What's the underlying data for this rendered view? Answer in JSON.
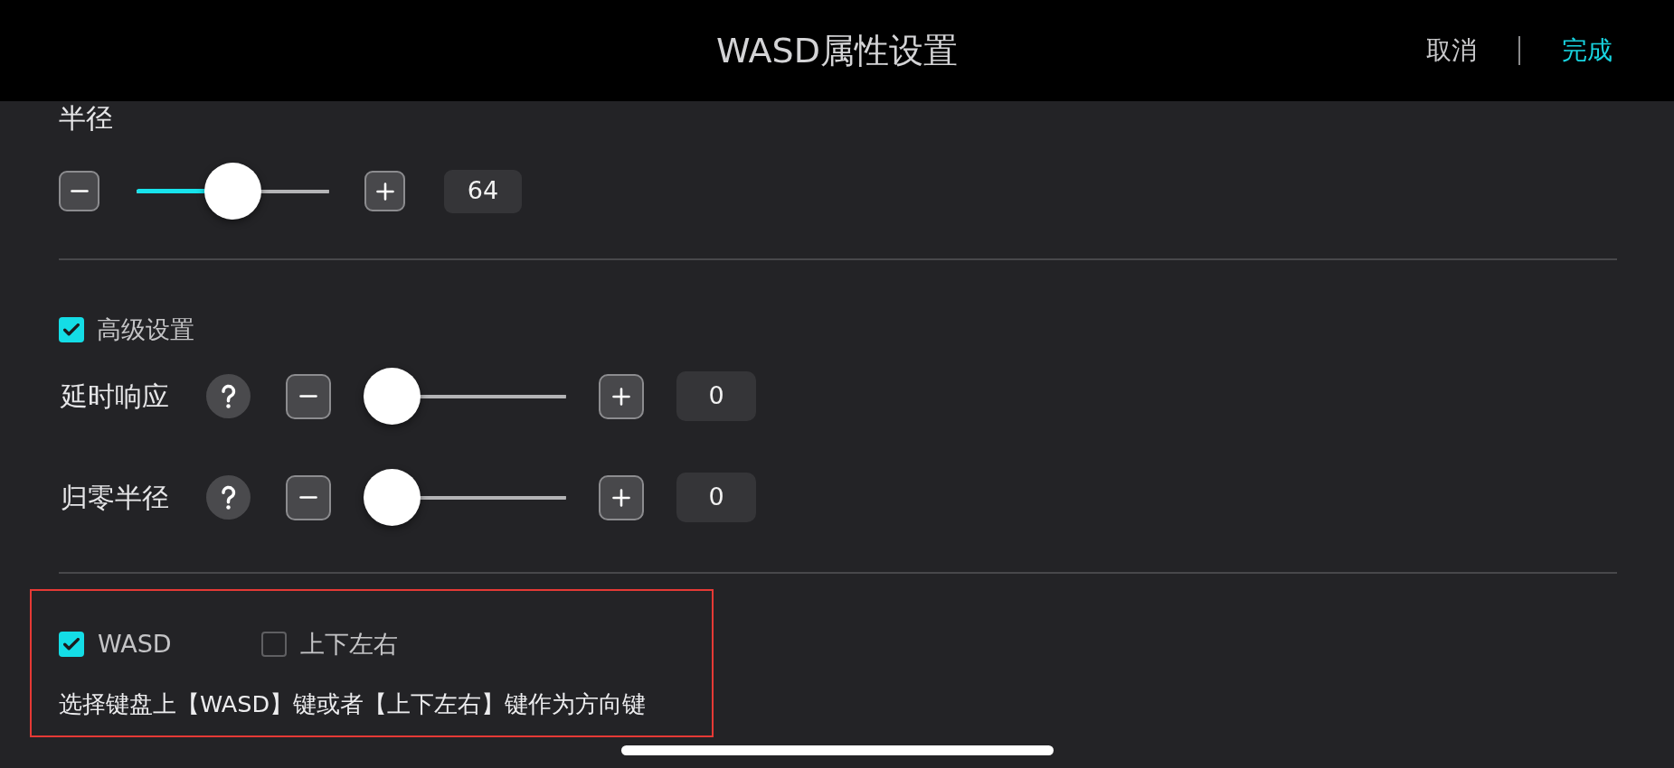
{
  "header": {
    "title": "WASD属性设置",
    "cancel": "取消",
    "done": "完成"
  },
  "radius": {
    "label": "半径",
    "level": 0.5,
    "value": "64"
  },
  "advanced": {
    "label": "高级设置",
    "checked": true,
    "rows": [
      {
        "label": "延时响应",
        "level": 0,
        "value": "0"
      },
      {
        "label": "归零半径",
        "level": 0,
        "value": "0"
      }
    ]
  },
  "direction_keys": {
    "highlighted": true,
    "options": [
      {
        "label": "WASD",
        "checked": true
      },
      {
        "label": "上下左右",
        "checked": false
      }
    ],
    "description": "选择键盘上【WASD】键或者【上下左右】键作为方向键"
  }
}
